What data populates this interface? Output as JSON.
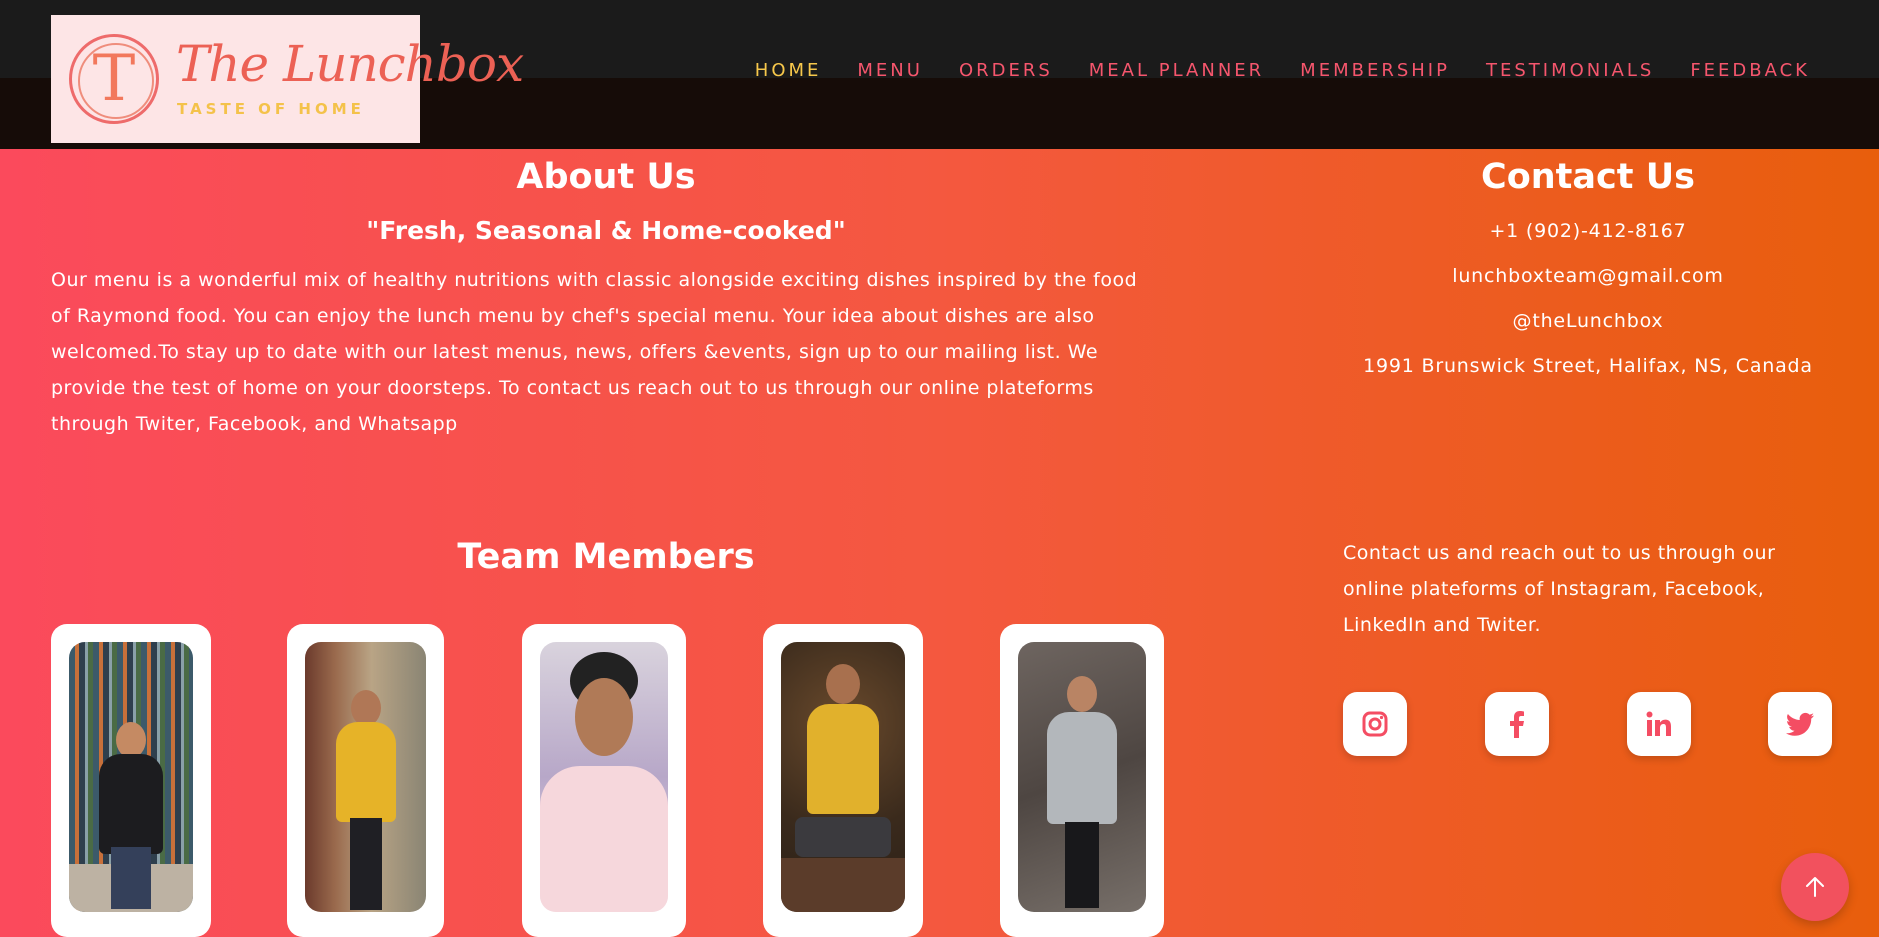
{
  "brand": {
    "letter": "T",
    "name": "The Lunchbox",
    "tagline": "TASTE OF HOME"
  },
  "nav": {
    "items": [
      {
        "label": "HOME",
        "active": true
      },
      {
        "label": "MENU",
        "active": false
      },
      {
        "label": "ORDERS",
        "active": false
      },
      {
        "label": "MEAL PLANNER",
        "active": false
      },
      {
        "label": "MEMBERSHIP",
        "active": false
      },
      {
        "label": "TESTIMONIALS",
        "active": false
      },
      {
        "label": "FEEDBACK",
        "active": false
      }
    ]
  },
  "about": {
    "title": "About Us",
    "tagline": "\"Fresh, Seasonal & Home-cooked\"",
    "text": "Our menu is a wonderful mix of healthy nutritions with classic alongside exciting dishes inspired by the food of Raymond food. You can enjoy the lunch menu by chef's special menu. Your idea about dishes are also welcomed.To stay up to date with our latest menus, news, offers &events, sign up to our mailing list. We provide the test of home on your doorsteps. To contact us reach out to us through our online plateforms through Twiter, Facebook, and Whatsapp"
  },
  "contact": {
    "title": "Contact Us",
    "phone": "+1 (902)-412-8167",
    "email": "lunchboxteam@gmail.com",
    "handle": "@theLunchbox",
    "address": "1991 Brunswick Street, Halifax, NS, Canada",
    "blurb": "Contact us and reach out to us through our online plateforms of Instagram, Facebook, LinkedIn and Twiter.",
    "socials": [
      "instagram-icon",
      "facebook-icon",
      "linkedin-icon",
      "twitter-icon"
    ]
  },
  "team": {
    "title": "Team Members"
  },
  "colors": {
    "accent": "#f44d63",
    "nav_active": "#f7c84b",
    "nav_default": "#f6566d",
    "gradient_start": "#fb4a5c",
    "gradient_end": "#e85e0c"
  }
}
